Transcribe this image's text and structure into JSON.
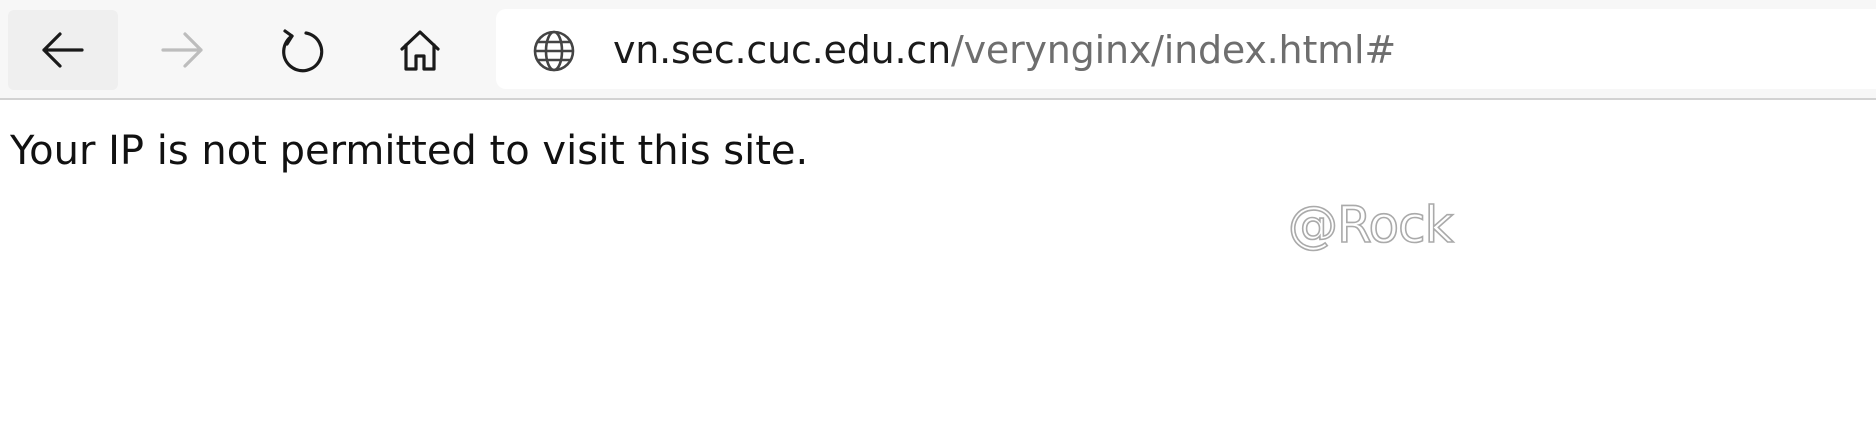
{
  "browser": {
    "back_icon": "arrow-left-icon",
    "forward_icon": "arrow-right-icon",
    "refresh_icon": "refresh-icon",
    "home_icon": "home-icon",
    "site_icon": "globe-icon",
    "address": {
      "host": "vn.sec.cuc.edu.cn",
      "path": "/verynginx/index.html#"
    },
    "colors": {
      "toolbar_bg": "#f7f7f7",
      "url_host": "#1a1a1a",
      "url_path": "#6e6e6e",
      "forward_disabled": "#bdbdbd"
    }
  },
  "page": {
    "message": "Your IP is not permitted to visit this site."
  },
  "watermark": {
    "text": "@Rock"
  }
}
